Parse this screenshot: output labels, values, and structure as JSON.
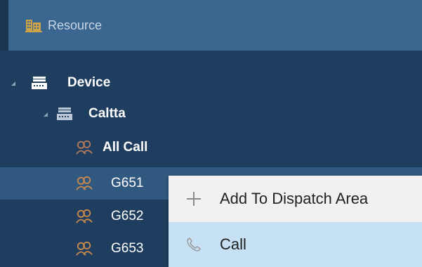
{
  "header": {
    "icon": "building-icon",
    "title": "Resource"
  },
  "tree": {
    "device": {
      "label": "Device",
      "icon": "device-icon",
      "expanded": true
    },
    "caltta": {
      "label": "Caltta",
      "icon": "device-icon",
      "expanded": true
    },
    "groups": [
      {
        "label": "All Call",
        "icon": "group-icon",
        "selected": false
      },
      {
        "label": "G651",
        "icon": "group-icon",
        "selected": true
      },
      {
        "label": "G652",
        "icon": "group-icon",
        "selected": false
      },
      {
        "label": "G653",
        "icon": "group-icon",
        "selected": false
      }
    ]
  },
  "context_menu": {
    "items": [
      {
        "label": "Add To Dispatch Area",
        "icon": "plus-icon"
      },
      {
        "label": "Call",
        "icon": "phone-icon"
      }
    ]
  }
}
